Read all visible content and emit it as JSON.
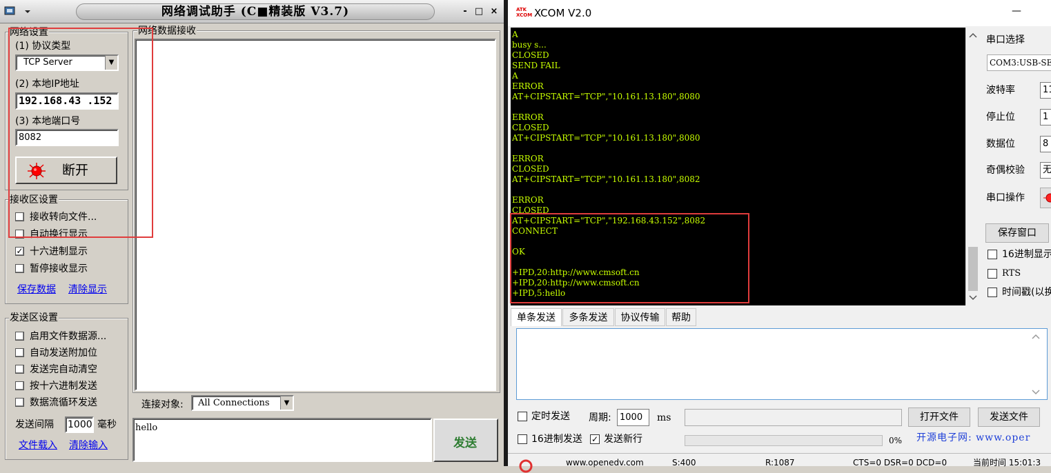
{
  "net_window": {
    "title": "网络调试助手 (C■精装版 V3.7)",
    "controls": {
      "minimize": "-",
      "maximize": "□",
      "close": "×"
    },
    "net_settings": {
      "group_label": "网络设置",
      "protocol_label": "(1) 协议类型",
      "protocol_value": "TCP Server",
      "ip_label": "(2) 本地IP地址",
      "ip_value": "192.168.43 .152",
      "port_label": "(3) 本地端口号",
      "port_value": "8082",
      "disconnect_label": "断开"
    },
    "receive_settings": {
      "group_label": "接收区设置",
      "options": [
        {
          "label": "接收转向文件...",
          "checked": false
        },
        {
          "label": "自动换行显示",
          "checked": false
        },
        {
          "label": "十六进制显示",
          "checked": true
        },
        {
          "label": "暂停接收显示",
          "checked": false
        }
      ],
      "save_link": "保存数据",
      "clear_link": "清除显示"
    },
    "send_settings": {
      "group_label": "发送区设置",
      "options": [
        {
          "label": "启用文件数据源...",
          "checked": false
        },
        {
          "label": "自动发送附加位",
          "checked": false
        },
        {
          "label": "发送完自动清空",
          "checked": false
        },
        {
          "label": "按十六进制发送",
          "checked": false
        },
        {
          "label": "数据流循环发送",
          "checked": false
        }
      ],
      "interval_label": "发送间隔",
      "interval_value": "1000",
      "interval_unit": "毫秒",
      "load_link": "文件载入",
      "clear_link": "清除输入"
    },
    "receive_area": {
      "label": "网络数据接收"
    },
    "connection": {
      "label": "连接对象:",
      "value": "All Connections"
    },
    "send_text": "hello",
    "send_button": "发送"
  },
  "xcom": {
    "title": "XCOM V2.0",
    "logo_text": "ATK XCOM",
    "minimize": "—",
    "terminal_lines": [
      "A",
      "busy s...",
      "CLOSED",
      "SEND FAIL",
      "A",
      "ERROR",
      "AT+CIPSTART=\"TCP\",\"10.161.13.180\",8080",
      "",
      "ERROR",
      "CLOSED",
      "AT+CIPSTART=\"TCP\",\"10.161.13.180\",8080",
      "",
      "ERROR",
      "CLOSED",
      "AT+CIPSTART=\"TCP\",\"10.161.13.180\",8082",
      "",
      "ERROR",
      "CLOSED",
      "AT+CIPSTART=\"TCP\",\"192.168.43.152\",8082",
      "CONNECT",
      "",
      "OK",
      "",
      "+IPD,20:http://www.cmsoft.cn",
      "+IPD,20:http://www.cmsoft.cn",
      "+IPD,5:hello"
    ],
    "side": {
      "port_select_label": "串口选择",
      "port_value": "COM3:USB-SER",
      "baud_label": "波特率",
      "baud_value": "11",
      "stop_label": "停止位",
      "stop_value": "1",
      "data_label": "数据位",
      "data_value": "8",
      "parity_label": "奇偶校验",
      "parity_value": "无",
      "op_label": "串口操作",
      "save_window": "保存窗口",
      "hex_display": "16进制显示",
      "rts": "RTS",
      "timestamp": "时间戳(以换"
    },
    "tabs": [
      "单条发送",
      "多条发送",
      "协议传输",
      "帮助"
    ],
    "bottom": {
      "timed_send": "定时发送",
      "period_label": "周期:",
      "period_value": "1000",
      "period_unit": "ms",
      "open_file": "打开文件",
      "send_file": "发送文件",
      "hex_send": "16进制发送",
      "send_newline": "发送新行",
      "progress": "0%",
      "ad_text": "开源电子网: www.oper"
    },
    "status": {
      "url": "www.openedv.com",
      "s": "S:400",
      "r": "R:1087",
      "signals": "CTS=0 DSR=0 DCD=0",
      "time": "当前时间 15:01:3"
    }
  }
}
